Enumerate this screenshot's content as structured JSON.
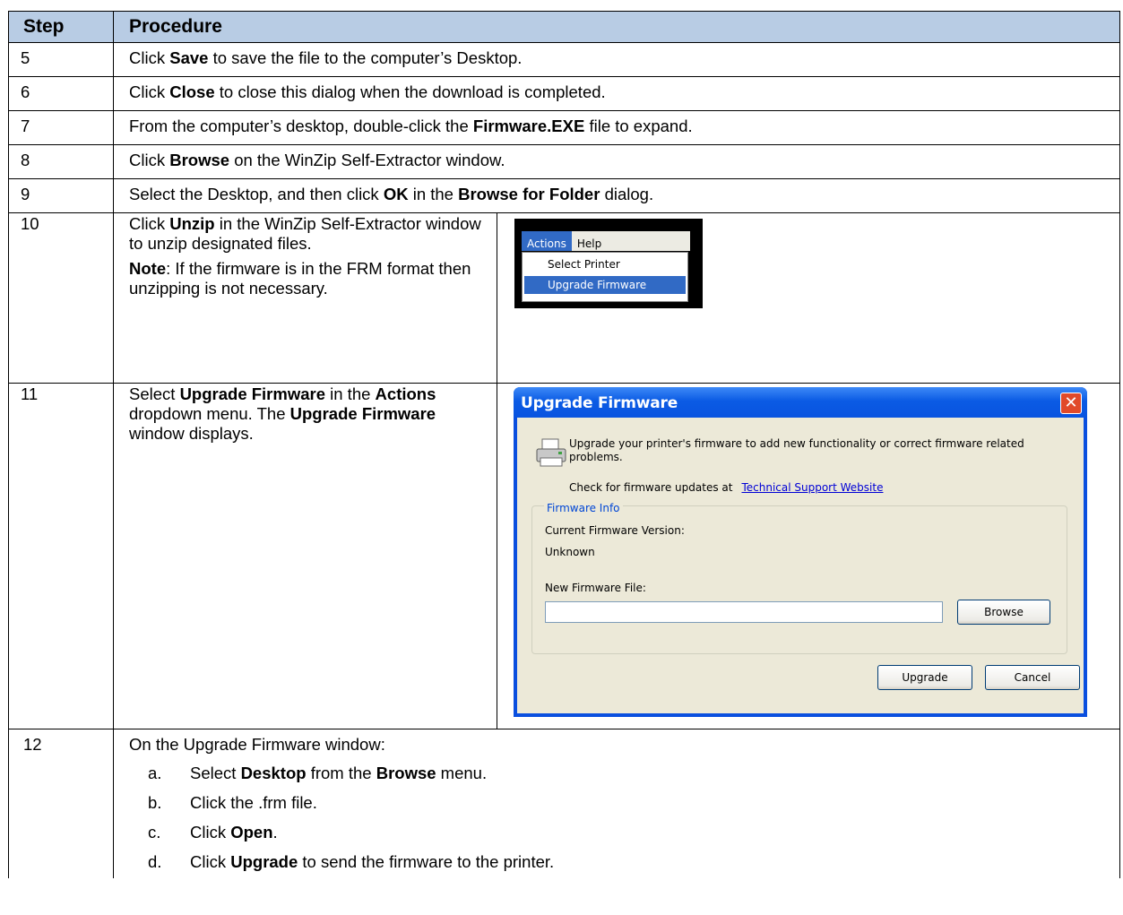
{
  "table": {
    "header": {
      "step": "Step",
      "procedure": "Procedure"
    },
    "rows": {
      "r5": {
        "step": "5",
        "t1": "Click ",
        "b1": "Save",
        "t2": " to save the file to the computer’s Desktop."
      },
      "r6": {
        "step": "6",
        "t1": "Click ",
        "b1": "Close",
        "t2": " to close this dialog when the download is completed."
      },
      "r7": {
        "step": "7",
        "t1": "From the computer’s desktop, double-click the ",
        "b1": "Firmware.EXE",
        "t2": " file to expand."
      },
      "r8": {
        "step": "8",
        "t1": "Click ",
        "b1": "Browse",
        "t2": " on the WinZip Self-Extractor window."
      },
      "r9": {
        "step": "9",
        "t1": "Select the Desktop, and then click ",
        "b1": "OK",
        "t2": " in the ",
        "b2": "Browse for Folder",
        "t3": " dialog."
      },
      "r10": {
        "step": "10",
        "t1": "Click ",
        "b1": "Unzip",
        "t2": " in the WinZip Self-Extractor window to unzip designated files.",
        "note_bold": "Note",
        "note_text": ": If the firmware is in the FRM format then unzipping is not necessary."
      },
      "r11": {
        "step": "11",
        "t1": "Select ",
        "b1": "Upgrade Firmware",
        "t2": " in the ",
        "b2": "Actions",
        "t3": " dropdown menu. The ",
        "b3": "Upgrade Firmware",
        "t4": " window displays."
      },
      "r12": {
        "step": "12",
        "intro": "On the Upgrade Firmware window:",
        "a": {
          "letter": "a.",
          "t1": "Select ",
          "b1": "Desktop",
          "t2": " from the ",
          "b2": "Browse",
          "t3": " menu."
        },
        "b": {
          "letter": "b.",
          "t1": "Click the .frm file."
        },
        "c": {
          "letter": "c.",
          "t1": "Click ",
          "b1": "Open",
          "t2": "."
        },
        "d": {
          "letter": "d.",
          "t1": "Click ",
          "b1": "Upgrade",
          "t2": " to send the firmware to the printer."
        }
      }
    }
  },
  "menu_screenshot": {
    "actions": "Actions",
    "help": "Help",
    "items": [
      "Select Printer",
      "Upgrade Firmware"
    ]
  },
  "dialog": {
    "title": "Upgrade Firmware",
    "close_glyph": "✕",
    "description": "Upgrade your printer's firmware to add new functionality or correct firmware related problems.",
    "check_text": "Check for firmware updates at",
    "link_text": "Technical Support Website",
    "group_label": "Firmware Info",
    "current_label": "Current Firmware Version:",
    "current_value": "Unknown",
    "new_file_label": "New Firmware File:",
    "new_file_value": "",
    "browse_label": "Browse",
    "upgrade_label": "Upgrade",
    "cancel_label": "Cancel"
  },
  "colors": {
    "header_bg": "#b8cce4",
    "xp_title_blue": "#0b5be4",
    "dialog_bg": "#ece9d8",
    "close_red": "#e14a2a"
  }
}
